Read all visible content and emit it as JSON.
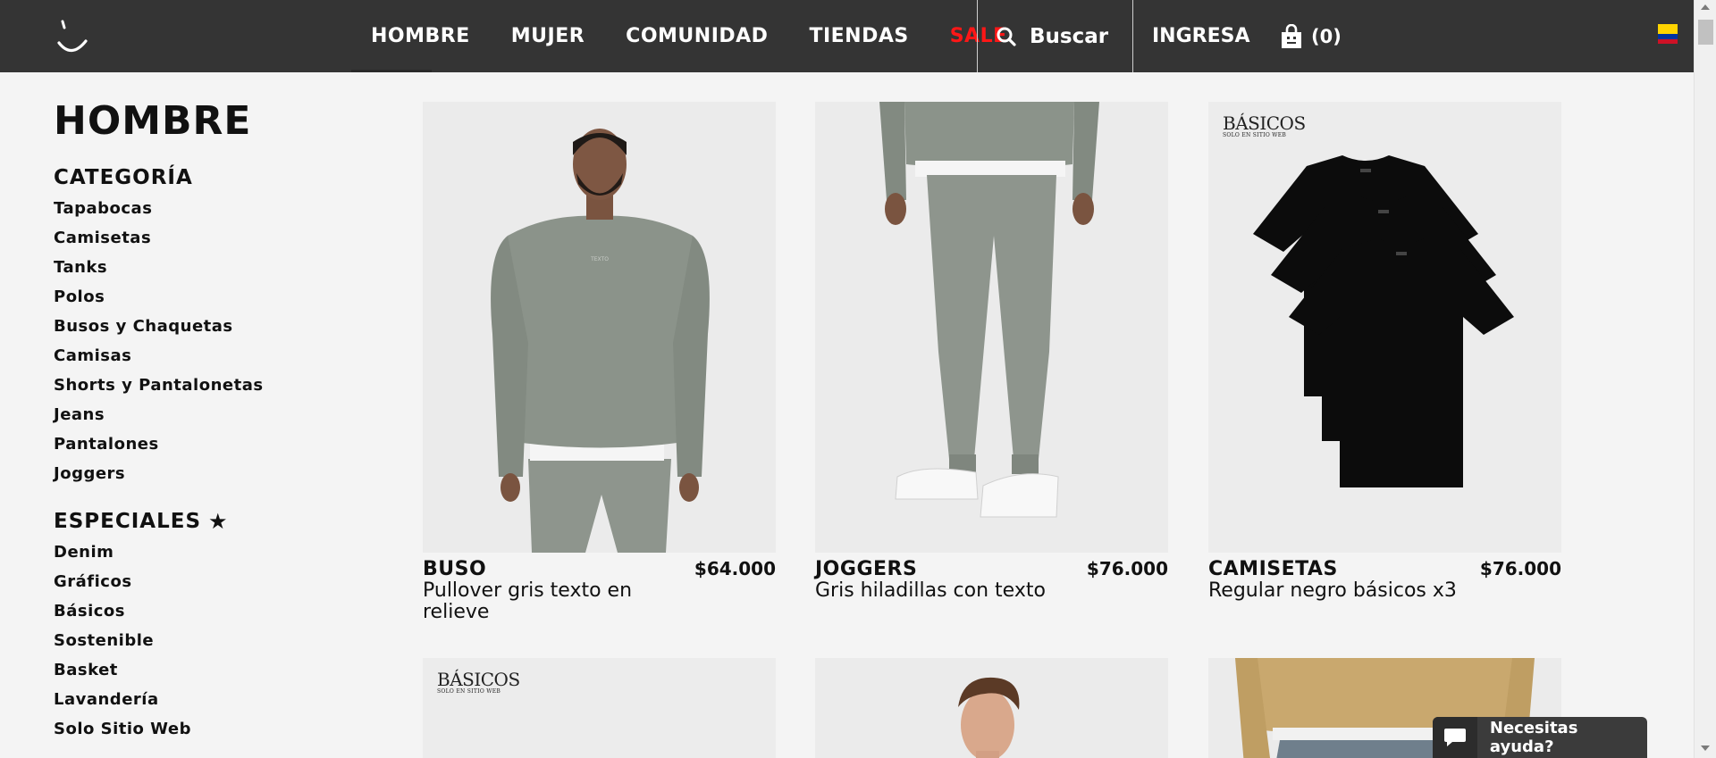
{
  "nav": {
    "items": [
      {
        "label": "HOMBRE"
      },
      {
        "label": "MUJER"
      },
      {
        "label": "COMUNIDAD"
      },
      {
        "label": "TIENDAS"
      },
      {
        "label": "SALE"
      }
    ],
    "search_label": "Buscar",
    "login_label": "INGRESA",
    "cart_label": "(0)",
    "sale_color": "#ff1717",
    "bar_color": "#343434"
  },
  "sidebar": {
    "title": "HOMBRE",
    "categoria": {
      "title": "CATEGORÍA",
      "items": [
        "Tapabocas",
        "Camisetas",
        "Tanks",
        "Polos",
        "Busos y Chaquetas",
        "Camisas",
        "Shorts y Pantalonetas",
        "Jeans",
        "Pantalones",
        "Joggers"
      ]
    },
    "especiales": {
      "title": "ESPECIALES",
      "icon": "star-icon",
      "items": [
        "Denim",
        "Gráficos",
        "Básicos",
        "Sostenible",
        "Basket",
        "Lavandería",
        "Solo Sitio Web"
      ]
    }
  },
  "products": [
    {
      "category": "BUSO",
      "price": "$64.000",
      "name": "Pullover gris texto en relieve"
    },
    {
      "category": "JOGGERS",
      "price": "$76.000",
      "name": "Gris hiladillas con texto"
    },
    {
      "category": "CAMISETAS",
      "price": "$76.000",
      "name": "Regular negro básicos x3"
    }
  ],
  "image_labels": {
    "basicos": "BÁSICOS",
    "basicos_sub": "SOLO EN SITIO WEB",
    "print_text": "TEXTO"
  },
  "chat": {
    "label": "Necesitas ayuda?"
  }
}
